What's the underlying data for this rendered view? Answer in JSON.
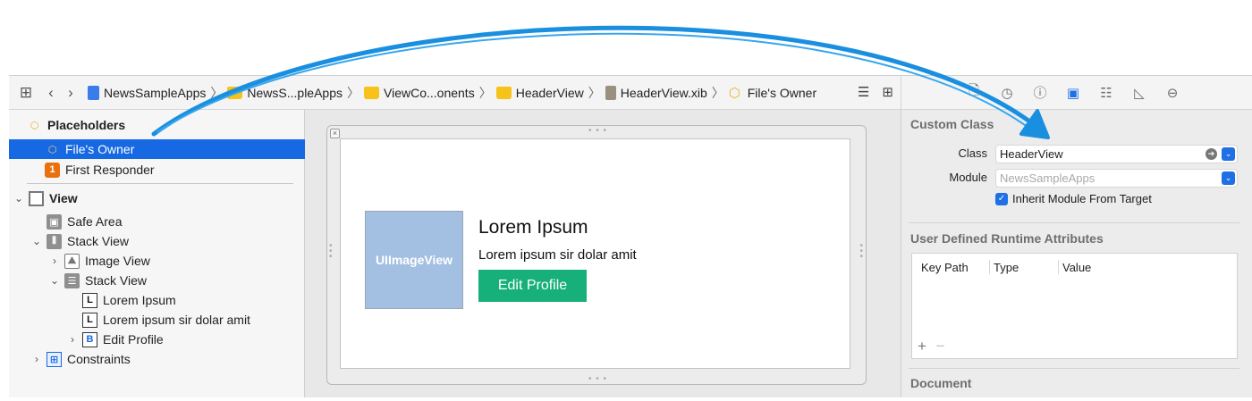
{
  "jumpbar": {
    "crumbs": [
      {
        "label": "NewsSampleApps",
        "icon": "project-icon"
      },
      {
        "label": "NewsS...pleApps",
        "icon": "folder-icon"
      },
      {
        "label": "ViewCo...onents",
        "icon": "folder-icon"
      },
      {
        "label": "HeaderView",
        "icon": "folder-icon"
      },
      {
        "label": "HeaderView.xib",
        "icon": "xib-file-icon"
      },
      {
        "label": "File's Owner",
        "icon": "placeholder-cube-icon"
      }
    ]
  },
  "outline": {
    "placeholders": "Placeholders",
    "files_owner": "File's Owner",
    "first_responder": "First Responder",
    "view": "View",
    "safe_area": "Safe Area",
    "stack_view": "Stack View",
    "image_view": "Image View",
    "inner_stack_view": "Stack View",
    "lorem_ipsum": "Lorem Ipsum",
    "lorem_sub": "Lorem ipsum sir dolar amit",
    "edit_profile": "Edit Profile",
    "constraints": "Constraints",
    "icon_letters": {
      "responder": "1",
      "label": "L",
      "button": "B"
    }
  },
  "canvas": {
    "image_view_label": "UIImageView",
    "title": "Lorem Ipsum",
    "subtitle": "Lorem ipsum sir dolar amit",
    "button": "Edit Profile",
    "button_color": "#17b07a",
    "image_color": "#a3c0e2"
  },
  "inspector": {
    "custom_class_title": "Custom Class",
    "class_label": "Class",
    "class_value": "HeaderView",
    "module_label": "Module",
    "module_placeholder": "NewsSampleApps",
    "inherit_label": "Inherit Module From Target",
    "inherit_checked": true,
    "udra_title": "User Defined Runtime Attributes",
    "columns": [
      "Key Path",
      "Type",
      "Value"
    ],
    "add": "+",
    "remove": "−",
    "document_title": "Document"
  },
  "colors": {
    "selection": "#1668e3",
    "arrow": "#1a8fe0"
  }
}
